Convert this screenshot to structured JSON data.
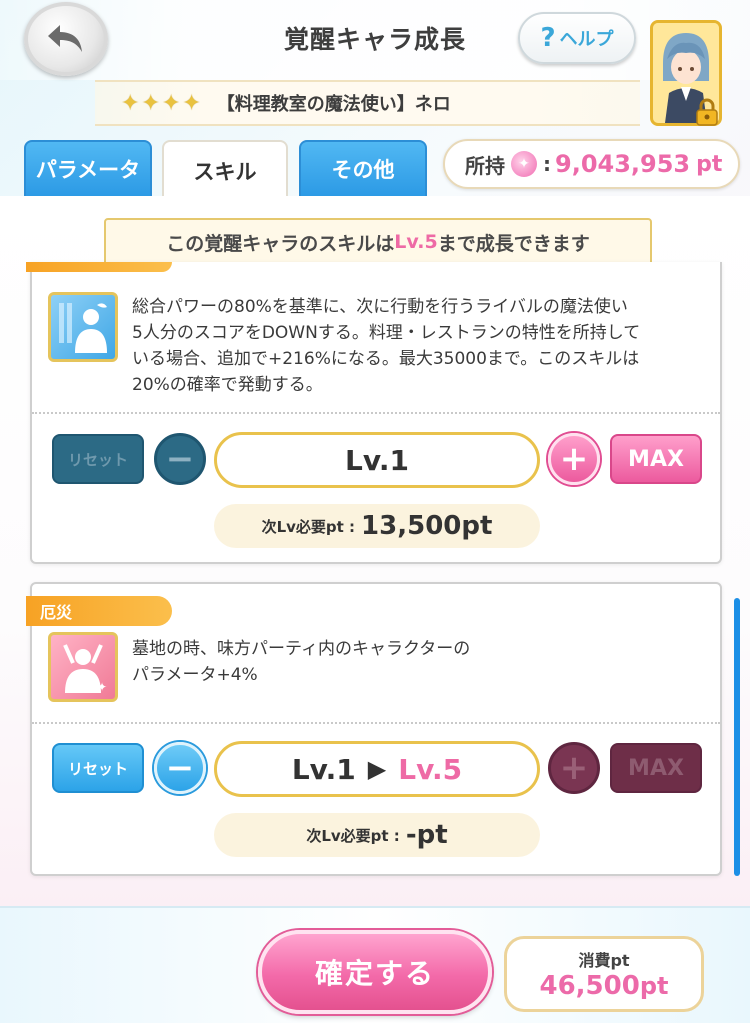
{
  "header": {
    "title": "覚醒キャラ成長",
    "help_label": "ヘルプ",
    "help_q": "?"
  },
  "character": {
    "stars": [
      "✦",
      "✦",
      "✦",
      "✦"
    ],
    "name": "【料理教室の魔法使い】ネロ"
  },
  "tabs": [
    {
      "label": "パラメータ",
      "active": false
    },
    {
      "label": "スキル",
      "active": true
    },
    {
      "label": "その他",
      "active": false
    }
  ],
  "points": {
    "label": "所持",
    "separator": ":",
    "value": "9,043,953",
    "unit": "pt"
  },
  "notice": {
    "prefix": "この覚醒キャラのスキルは",
    "level": "Lv.5",
    "suffix": "まで成長できます"
  },
  "skills": [
    {
      "category": "",
      "description_lines": [
        "総合パワーの80%を基準に、次に行動を行うライバルの魔法使い",
        "5人分のスコアをDOWNする。料理・レストランの特性を所持して",
        "いる場合、追加で+216%になる。最大35000まで。このスキルは",
        "20%の確率で発動する。"
      ],
      "reset_label": "リセット",
      "minus": "−",
      "plus": "+",
      "max_label": "MAX",
      "level_current": "Lv.1",
      "level_next": "",
      "req_label": "次Lv必要pt :",
      "req_value": "13,500pt"
    },
    {
      "category": "厄災",
      "description_lines": [
        "墓地の時、味方パーティ内のキャラクターの",
        "パラメータ+4%"
      ],
      "reset_label": "リセット",
      "minus": "−",
      "plus": "+",
      "max_label": "MAX",
      "level_current": "Lv.1",
      "level_arrow": "▶",
      "level_next": "Lv.5",
      "req_label": "次Lv必要pt :",
      "req_value": "-pt"
    }
  ],
  "footer": {
    "confirm_label": "確定する",
    "cost_label": "消費pt",
    "cost_value": "46,500",
    "cost_unit": "pt"
  },
  "colors": {
    "accent_pink": "#ec6aa9",
    "accent_blue": "#2ca3e8",
    "gold": "#e9c24c"
  }
}
